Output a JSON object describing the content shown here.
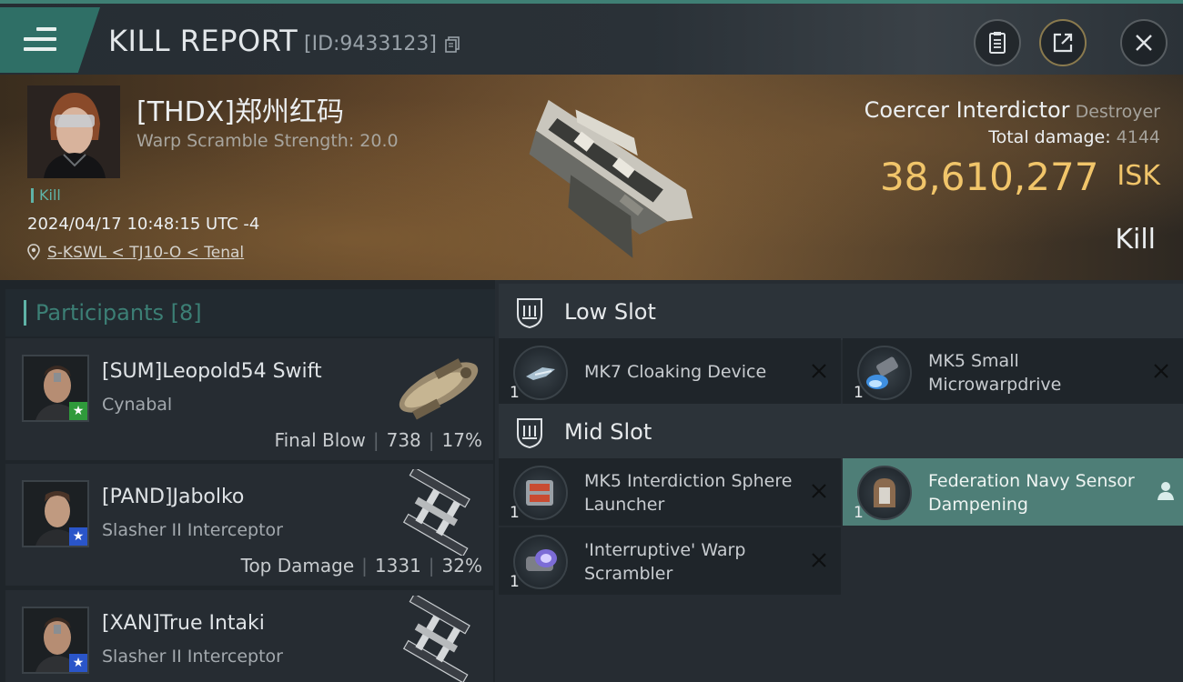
{
  "topbar": {
    "title": "KILL REPORT",
    "report_id": "[ID:9433123]"
  },
  "victim": {
    "name": "[THDX]郑州红码",
    "stat": "Warp Scramble Strength: 20.0",
    "tag": "Kill",
    "time": "2024/04/17 10:48:15 UTC -4",
    "location": "S-KSWL < TJ10-O < Tenal"
  },
  "summary": {
    "ship": "Coercer Interdictor",
    "ship_class": "Destroyer",
    "damage_label": "Total damage:",
    "damage_value": "4144",
    "isk_amount": "38,610,277",
    "isk_unit": "ISK",
    "result": "Kill",
    "isk_color": "#f1c56a"
  },
  "participants": {
    "title": "Participants",
    "count": "[8]",
    "rows": [
      {
        "name": "[SUM]Leopold54 Swift",
        "ship": "Cynabal",
        "stat_label": "Final Blow",
        "damage": "738",
        "percent": "17%",
        "badge": "★"
      },
      {
        "name": "[PAND]Jabolko",
        "ship": "Slasher II Interceptor",
        "stat_label": "Top Damage",
        "damage": "1331",
        "percent": "32%",
        "badge": "★"
      },
      {
        "name": "[XAN]True Intaki",
        "ship": "Slasher II Interceptor",
        "stat_label": "",
        "damage": "",
        "percent": "",
        "badge": "★"
      }
    ]
  },
  "fittings": {
    "low_slot_title": "Low Slot",
    "mid_slot_title": "Mid Slot",
    "low": [
      {
        "name": "MK7 Cloaking Device",
        "qty": "1"
      },
      {
        "name": "MK5 Small Microwarpdrive",
        "qty": "1"
      }
    ],
    "mid": [
      {
        "name": "MK5 Interdiction Sphere Launcher",
        "qty": "1"
      },
      {
        "name": "Federation Navy Sensor Dampening",
        "qty": "1"
      },
      {
        "name": "'Interruptive' Warp Scrambler",
        "qty": "1"
      }
    ]
  },
  "colors": {
    "accent": "#5fb3a7",
    "highlight_row": "#4e7e77"
  }
}
